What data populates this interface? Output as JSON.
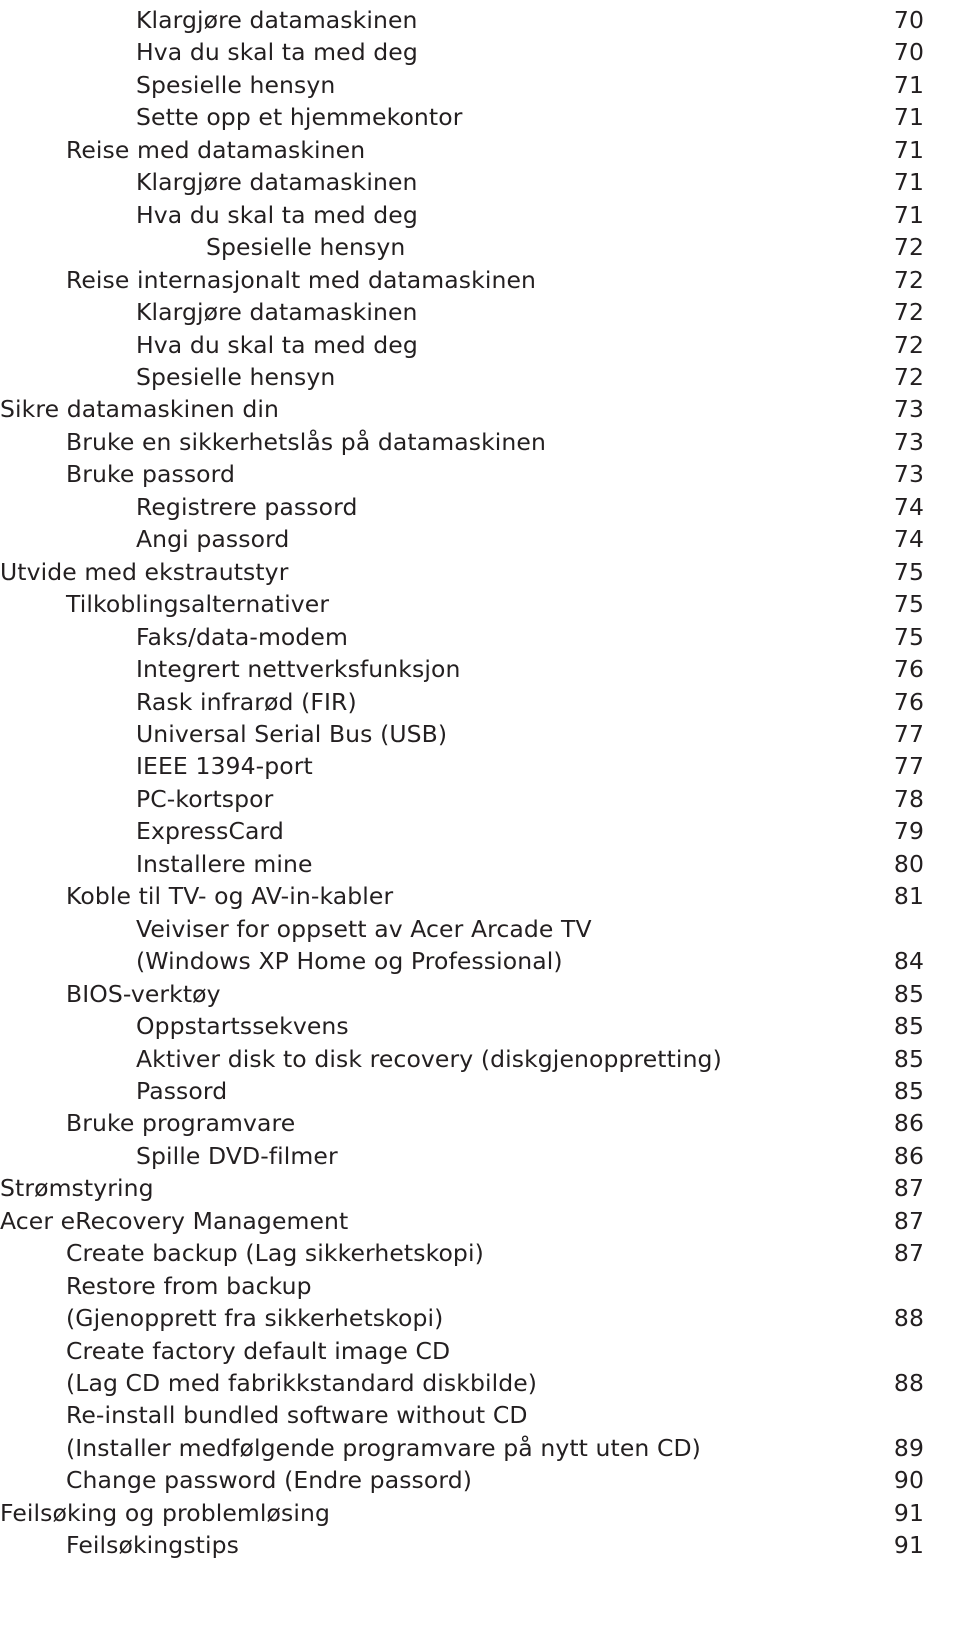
{
  "document": {
    "kind": "table-of-contents",
    "language": "Norwegian"
  },
  "toc": {
    "entries": [
      {
        "label": "Klargjøre datamaskinen",
        "page": "70",
        "level": 2
      },
      {
        "label": "Hva du skal ta med deg",
        "page": "70",
        "level": 2
      },
      {
        "label": "Spesielle hensyn",
        "page": "71",
        "level": 2
      },
      {
        "label": "Sette opp et hjemmekontor",
        "page": "71",
        "level": 2
      },
      {
        "label": "Reise med datamaskinen",
        "page": "71",
        "level": 1
      },
      {
        "label": "Klargjøre datamaskinen",
        "page": "71",
        "level": 2
      },
      {
        "label": "Hva du skal ta med deg",
        "page": "71",
        "level": 2
      },
      {
        "label": "Spesielle hensyn",
        "page": "72",
        "level": 3
      },
      {
        "label": "Reise internasjonalt med datamaskinen",
        "page": "72",
        "level": 1
      },
      {
        "label": "Klargjøre datamaskinen",
        "page": "72",
        "level": 2
      },
      {
        "label": "Hva du skal ta med deg",
        "page": "72",
        "level": 2
      },
      {
        "label": "Spesielle hensyn",
        "page": "72",
        "level": 2
      },
      {
        "label": "Sikre datamaskinen din",
        "page": "73",
        "level": 0
      },
      {
        "label": "Bruke en sikkerhetslås på datamaskinen",
        "page": "73",
        "level": 1
      },
      {
        "label": "Bruke passord",
        "page": "73",
        "level": 1
      },
      {
        "label": "Registrere passord",
        "page": "74",
        "level": 2
      },
      {
        "label": "Angi passord",
        "page": "74",
        "level": 2
      },
      {
        "label": "Utvide med ekstrautstyr",
        "page": "75",
        "level": 0
      },
      {
        "label": "Tilkoblingsalternativer",
        "page": "75",
        "level": 1
      },
      {
        "label": "Faks/data-modem",
        "page": "75",
        "level": 2
      },
      {
        "label": "Integrert nettverksfunksjon",
        "page": "76",
        "level": 2
      },
      {
        "label": "Rask infrarød (FIR)",
        "page": "76",
        "level": 2
      },
      {
        "label": "Universal Serial Bus (USB)",
        "page": "77",
        "level": 2
      },
      {
        "label": "IEEE 1394-port",
        "page": "77",
        "level": 2
      },
      {
        "label": "PC-kortspor",
        "page": "78",
        "level": 2
      },
      {
        "label": "ExpressCard",
        "page": "79",
        "level": 2
      },
      {
        "label": "Installere mine",
        "page": "80",
        "level": 2
      },
      {
        "label": "Koble til TV- og AV-in-kabler",
        "page": "81",
        "level": 1
      },
      {
        "label": "Veiviser for oppsett av Acer Arcade TV",
        "page": "",
        "level": 2
      },
      {
        "label": "(Windows XP Home  og Professional)",
        "page": "84",
        "level": 2
      },
      {
        "label": "BIOS-verktøy",
        "page": "85",
        "level": 1
      },
      {
        "label": "Oppstartssekvens",
        "page": "85",
        "level": 2
      },
      {
        "label": "Aktiver disk to disk recovery (diskgjenoppretting)",
        "page": "85",
        "level": 2
      },
      {
        "label": "Passord",
        "page": "85",
        "level": 2
      },
      {
        "label": "Bruke programvare",
        "page": "86",
        "level": 1
      },
      {
        "label": "Spille DVD-filmer",
        "page": "86",
        "level": 2
      },
      {
        "label": "Strømstyring",
        "page": "87",
        "level": 0
      },
      {
        "label": "Acer eRecovery Management",
        "page": "87",
        "level": 0
      },
      {
        "label": "Create backup (Lag sikkerhetskopi)",
        "page": "87",
        "level": 1
      },
      {
        "label": "Restore from backup",
        "page": "",
        "level": 1
      },
      {
        "label": "(Gjenopprett fra sikkerhetskopi)",
        "page": "88",
        "level": 1
      },
      {
        "label": "Create factory default image CD",
        "page": "",
        "level": 1
      },
      {
        "label": "(Lag CD med fabrikkstandard diskbilde)",
        "page": "88",
        "level": 1
      },
      {
        "label": "Re-install bundled software without CD",
        "page": "",
        "level": 1
      },
      {
        "label": "(Installer medfølgende programvare på nytt uten CD)",
        "page": "89",
        "level": 1
      },
      {
        "label": "Change password (Endre passord)",
        "page": "90",
        "level": 1
      },
      {
        "label": "Feilsøking og problemløsing",
        "page": "91",
        "level": 0
      },
      {
        "label": "Feilsøkingstips",
        "page": "91",
        "level": 1
      }
    ]
  }
}
